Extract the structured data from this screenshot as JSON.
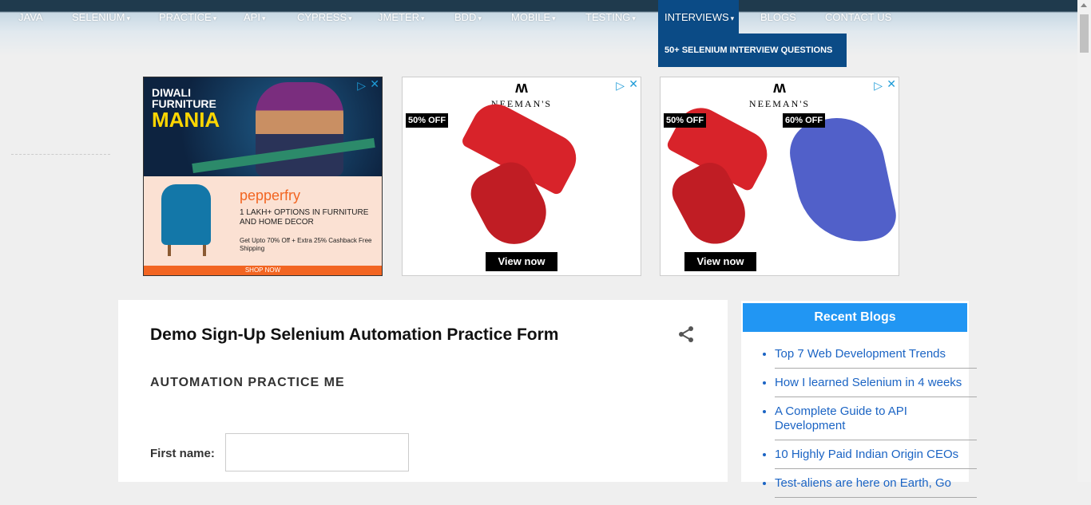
{
  "nav": {
    "items": [
      {
        "label": "JAVA",
        "caret": false
      },
      {
        "label": "SELENIUM",
        "caret": true
      },
      {
        "label": "PRACTICE",
        "caret": true
      },
      {
        "label": "API",
        "caret": true
      },
      {
        "label": "CYPRESS",
        "caret": true
      },
      {
        "label": "JMETER",
        "caret": true
      },
      {
        "label": "BDD",
        "caret": true
      },
      {
        "label": "MOBILE",
        "caret": true
      },
      {
        "label": "TESTING",
        "caret": true
      },
      {
        "label": "INTERVIEWS",
        "caret": true,
        "active": true
      },
      {
        "label": "BLOGS",
        "caret": false
      },
      {
        "label": "CONTACT US",
        "caret": false
      }
    ],
    "dropdown_item": "50+ SELENIUM INTERVIEW QUESTIONS",
    "active_color": "#0b4b86"
  },
  "ads": {
    "pepperfry": {
      "line1": "DIWALI",
      "line2": "FURNITURE",
      "line3": "MANIA",
      "brand": "pepperfry",
      "text": "1 LAKH+ OPTIONS IN FURNITURE AND HOME DECOR",
      "offer": "Get Upto 70% Off + Extra 25% Cashback Free Shipping",
      "cta": "SHOP NOW"
    },
    "neeman1": {
      "brand": "NEEMAN'S",
      "badge": "50% OFF",
      "cta": "View now"
    },
    "neeman2": {
      "brand": "NEEMAN'S",
      "badge1": "50% OFF",
      "badge2": "60% OFF",
      "cta": "View now"
    }
  },
  "post": {
    "title": "Demo Sign-Up Selenium Automation Practice Form",
    "section": "AUTOMATION PRACTICE ME",
    "first_name_label": "First name:",
    "first_name_value": ""
  },
  "sidebar": {
    "heading": "Recent Blogs",
    "heading_color": "#2196f3",
    "items": [
      "Top 7 Web Development Trends",
      "How I learned Selenium in 4 weeks",
      "A Complete Guide to API Development",
      "10 Highly Paid Indian Origin CEOs",
      "Test-aliens are here on Earth, Go"
    ]
  }
}
